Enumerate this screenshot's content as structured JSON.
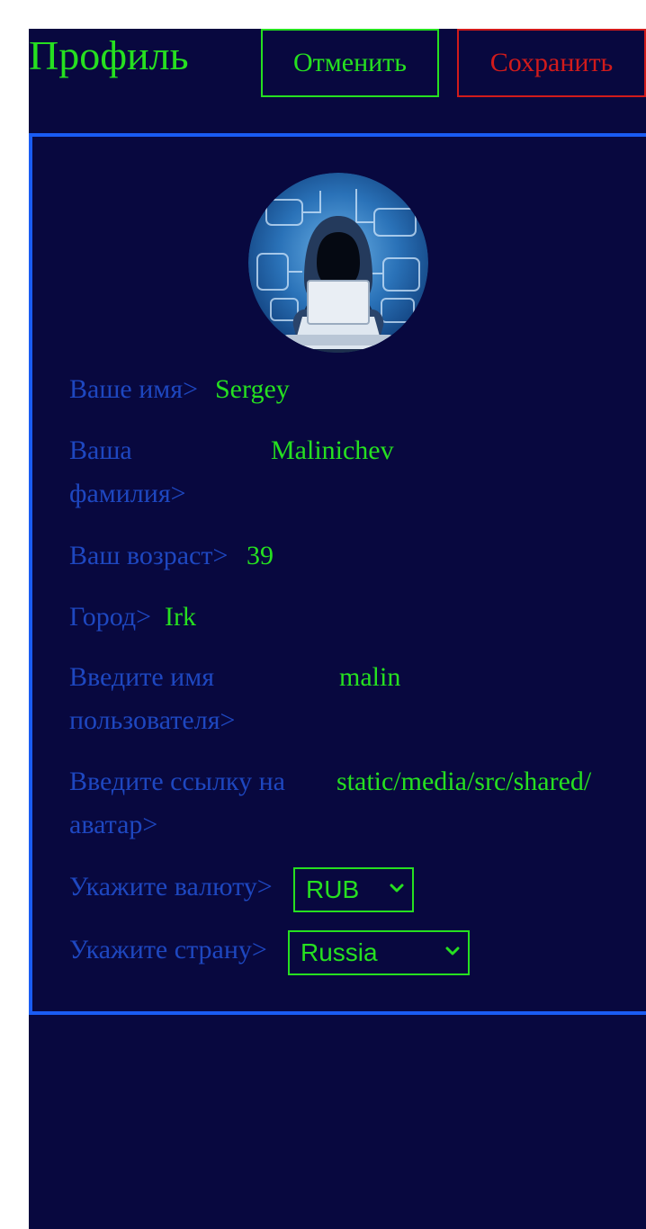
{
  "header": {
    "title": "Профиль",
    "cancel_label": "Отменить",
    "save_label": "Сохранить"
  },
  "profile": {
    "avatar_icon": "hacker-avatar",
    "fields": [
      {
        "label": "Ваше имя>",
        "value": "Sergey"
      },
      {
        "label": "Ваша фамилия>",
        "value": "Malinichev"
      },
      {
        "label": "Ваш возраст>",
        "value": "39"
      },
      {
        "label": "Город>",
        "value": "Irk"
      },
      {
        "label": "Введите имя пользователя>",
        "value": "malin"
      },
      {
        "label": "Введите ссылку на аватар>",
        "value": "static/media/src/shared/"
      }
    ],
    "currency": {
      "label": "Укажите валюту>",
      "selected": "RUB"
    },
    "country": {
      "label": "Укажите страну>",
      "selected": "Russia"
    }
  },
  "colors": {
    "background": "#08083f",
    "accent_green": "#26e020",
    "label_blue": "#1e47c0",
    "border_blue": "#1a5cf3",
    "danger_red": "#d11b1b"
  }
}
